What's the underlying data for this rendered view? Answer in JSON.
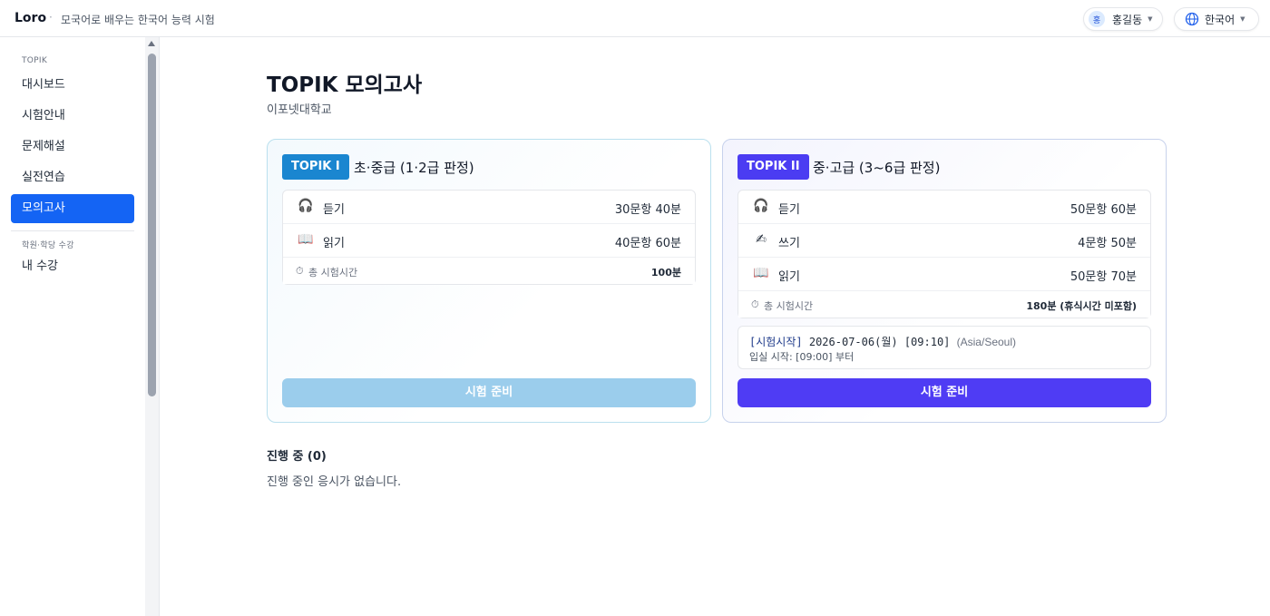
{
  "header": {
    "brand": "Loro",
    "separator": "·",
    "tagline": "모국어로 배우는 한국어 능력 시험",
    "user": {
      "avatar_initial": "홍",
      "name": "홍길동"
    },
    "language": {
      "label": "한국어"
    }
  },
  "sidebar": {
    "section_title": "TOPIK",
    "items": [
      {
        "label": "대시보드"
      },
      {
        "label": "시험안내"
      },
      {
        "label": "문제해설"
      },
      {
        "label": "실전연습"
      },
      {
        "label": "모의고사"
      }
    ],
    "section2_title": "학원·학당 수강",
    "items2": [
      {
        "label": "내 수강"
      }
    ]
  },
  "main": {
    "title": "TOPIK 모의고사",
    "subtitle": "이포넷대학교",
    "cards": [
      {
        "badge": "TOPIK I",
        "level": "초·중급 (1·2급 판정)",
        "sections": [
          {
            "icon": "headphones-icon",
            "name": "듣기",
            "value": "30문항 40분"
          },
          {
            "icon": "book-icon",
            "name": "읽기",
            "value": "40문항 60분"
          }
        ],
        "total_label": "총 시험시간",
        "total_value": "100분",
        "button": "시험 준비"
      },
      {
        "badge": "TOPIK II",
        "level": "중·고급 (3~6급 판정)",
        "sections": [
          {
            "icon": "headphones-icon",
            "name": "듣기",
            "value": "50문항 60분"
          },
          {
            "icon": "writing-hand-icon",
            "name": "쓰기",
            "value": "4문항 50분"
          },
          {
            "icon": "book-icon",
            "name": "읽기",
            "value": "50문항 70분"
          }
        ],
        "total_label": "총 시험시간",
        "total_value": "180분 (휴식시간 미포함)",
        "schedule": {
          "label": "[시험시작]",
          "datetime": "2026-07-06(월) [09:10]",
          "timezone": "(Asia/Seoul)",
          "entry": "입실 시작: [09:00] 부터"
        },
        "button": "시험 준비"
      }
    ],
    "progress": {
      "title": "진행 중 (0)",
      "empty": "진행 중인 응시가 없습니다."
    }
  },
  "colors": {
    "primary": "#1464f4",
    "topik1": "#1a86d0",
    "topik2": "#4b3cf2",
    "topik1_button_disabled": "#9bcdec"
  }
}
